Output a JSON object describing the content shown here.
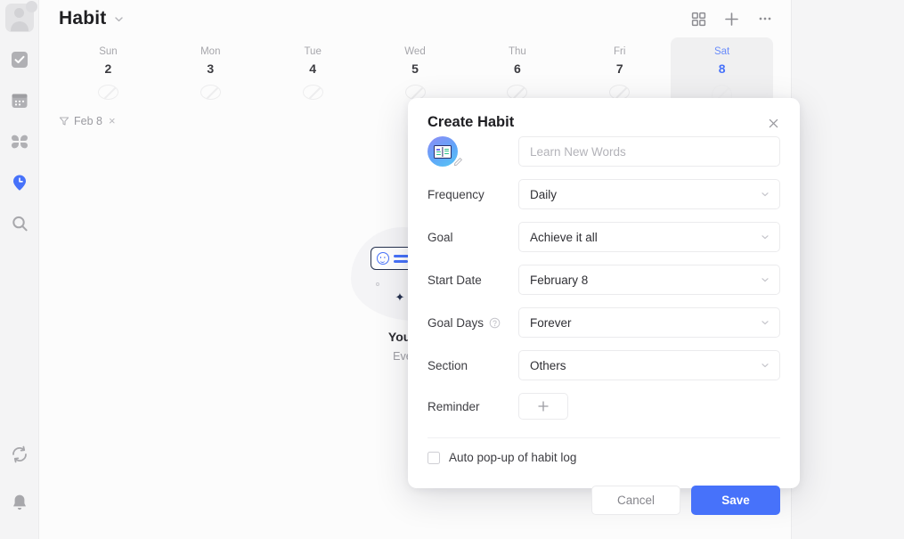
{
  "app": {
    "rail": {
      "avatar": {
        "name": "avatar"
      },
      "items": [
        {
          "id": "tasks",
          "icon": "checkbox-icon",
          "active": false
        },
        {
          "id": "calendar",
          "icon": "calendar-icon",
          "active": false
        },
        {
          "id": "matrix",
          "icon": "grid-four-icon",
          "active": false
        },
        {
          "id": "habit",
          "icon": "clock-pin-icon",
          "active": true
        },
        {
          "id": "search",
          "icon": "search-icon",
          "active": false
        }
      ],
      "bottom_items": [
        {
          "id": "sync",
          "icon": "sync-icon"
        },
        {
          "id": "notifications",
          "icon": "bell-icon"
        }
      ]
    },
    "header": {
      "title": "Habit",
      "chevron": "chevron-down-icon",
      "actions": [
        {
          "id": "grid-view",
          "icon": "grid-view-icon"
        },
        {
          "id": "add",
          "icon": "plus-icon"
        },
        {
          "id": "more",
          "icon": "more-horizontal-icon"
        }
      ]
    },
    "calendar": {
      "days": [
        {
          "dow": "Sun",
          "num": "2",
          "active": false
        },
        {
          "dow": "Mon",
          "num": "3",
          "active": false
        },
        {
          "dow": "Tue",
          "num": "4",
          "active": false
        },
        {
          "dow": "Wed",
          "num": "5",
          "active": false
        },
        {
          "dow": "Thu",
          "num": "6",
          "active": false
        },
        {
          "dow": "Fri",
          "num": "7",
          "active": false
        },
        {
          "dow": "Sat",
          "num": "8",
          "active": true
        }
      ]
    },
    "filter_chip": {
      "icon": "filter-icon",
      "label": "Feb 8",
      "remove": "×"
    },
    "empty_state": {
      "title": "You have",
      "subtitle": "Every littl"
    },
    "colors": {
      "accent": "#4772fa",
      "rail_bg": "#f4f4f5",
      "panel_bg": "#fcfcfc",
      "page_bg": "#f5f5f6"
    }
  },
  "modal": {
    "title": "Create Habit",
    "close_icon": "close-icon",
    "habit_icon": "book-icon",
    "name_input": {
      "value": "",
      "placeholder": "Learn New Words"
    },
    "fields": [
      {
        "label": "Frequency",
        "value": "Daily",
        "has_help": false
      },
      {
        "label": "Goal",
        "value": "Achieve it all",
        "has_help": false
      },
      {
        "label": "Start Date",
        "value": "February 8",
        "has_help": false
      },
      {
        "label": "Goal Days",
        "value": "Forever",
        "has_help": true
      },
      {
        "label": "Section",
        "value": "Others",
        "has_help": false
      }
    ],
    "reminder": {
      "label": "Reminder",
      "add_icon": "plus-icon"
    },
    "auto_popup": {
      "label": "Auto pop-up of habit log",
      "checked": false
    },
    "buttons": {
      "cancel": "Cancel",
      "save": "Save"
    }
  }
}
